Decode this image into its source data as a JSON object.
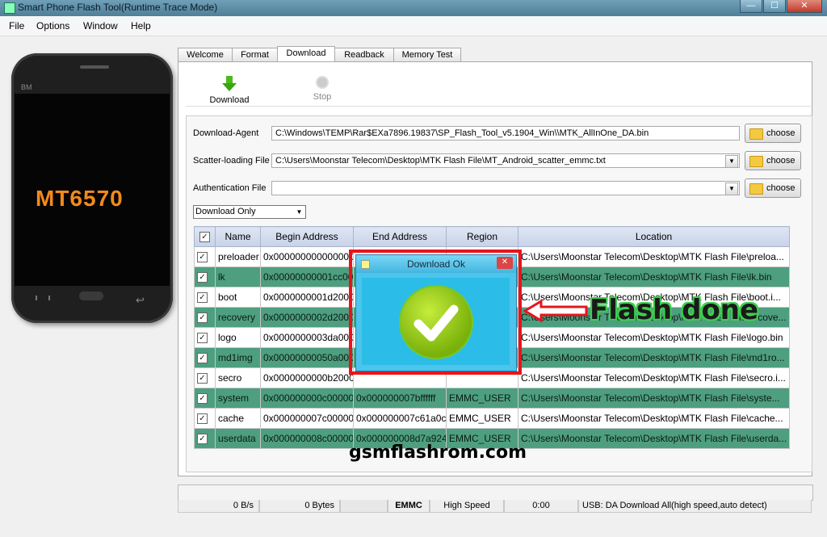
{
  "window": {
    "title": "Smart Phone Flash Tool(Runtime Trace Mode)",
    "minimize": "—",
    "maximize": "☐",
    "close": "✕"
  },
  "menu": [
    "File",
    "Options",
    "Window",
    "Help"
  ],
  "phone": {
    "brand": "BM",
    "model": "MT6570"
  },
  "tabs": [
    "Welcome",
    "Format",
    "Download",
    "Readback",
    "Memory Test"
  ],
  "active_tab": "Download",
  "toolbar": {
    "download_label": "Download",
    "stop_label": "Stop"
  },
  "fields": {
    "download_agent": {
      "label": "Download-Agent",
      "value": "C:\\Windows\\TEMP\\Rar$EXa7896.19837\\SP_Flash_Tool_v5.1904_Win\\\\MTK_AllInOne_DA.bin"
    },
    "scatter": {
      "label": "Scatter-loading File",
      "value": "C:\\Users\\Moonstar Telecom\\Desktop\\MTK Flash File\\MT_Android_scatter_emmc.txt"
    },
    "auth": {
      "label": "Authentication File",
      "value": ""
    },
    "choose_label": "choose",
    "mode": "Download Only"
  },
  "table": {
    "headers": [
      "Name",
      "Begin Address",
      "End Address",
      "Region",
      "Location"
    ],
    "rows": [
      [
        "preloader",
        "0x0000000000000000",
        "",
        "",
        "C:\\Users\\Moonstar Telecom\\Desktop\\MTK Flash File\\preloa..."
      ],
      [
        "lk",
        "0x00000000001cc0000",
        "",
        "",
        "C:\\Users\\Moonstar Telecom\\Desktop\\MTK Flash File\\lk.bin"
      ],
      [
        "boot",
        "0x0000000001d20000",
        "",
        "",
        "C:\\Users\\Moonstar Telecom\\Desktop\\MTK Flash File\\boot.i..."
      ],
      [
        "recovery",
        "0x0000000002d20000",
        "",
        "",
        "C:\\Users\\Moonstar Telecom\\Desktop\\MTK Flash File\\recove..."
      ],
      [
        "logo",
        "0x0000000003da0000",
        "",
        "",
        "C:\\Users\\Moonstar Telecom\\Desktop\\MTK Flash File\\logo.bin"
      ],
      [
        "md1img",
        "0x00000000050a0000",
        "",
        "",
        "C:\\Users\\Moonstar Telecom\\Desktop\\MTK Flash File\\md1ro..."
      ],
      [
        "secro",
        "0x0000000000b200000",
        "",
        "",
        "C:\\Users\\Moonstar Telecom\\Desktop\\MTK Flash File\\secro.i..."
      ],
      [
        "system",
        "0x000000000c000000",
        "0x000000007bffffff",
        "EMMC_USER",
        "C:\\Users\\Moonstar Telecom\\Desktop\\MTK Flash File\\syste..."
      ],
      [
        "cache",
        "0x000000007c000000",
        "0x000000007c61a0cf",
        "EMMC_USER",
        "C:\\Users\\Moonstar Telecom\\Desktop\\MTK Flash File\\cache..."
      ],
      [
        "userdata",
        "0x000000008c000000",
        "0x000000008d7a9243",
        "EMMC_USER",
        "C:\\Users\\Moonstar Telecom\\Desktop\\MTK Flash File\\userda..."
      ]
    ]
  },
  "dialog": {
    "title": "Download Ok",
    "close": "✕"
  },
  "annotation": "Flash done",
  "watermark": "gsmflashrom.com",
  "status": {
    "speed": "0 B/s",
    "bytes": "0 Bytes",
    "storage": "EMMC",
    "mode": "High Speed",
    "time": "0:00",
    "usb": "USB: DA Download All(high speed,auto detect)"
  },
  "colors": {
    "row_green": "#4e9e80",
    "dialog_bg": "#4cc4ec",
    "highlight": "#e8141b",
    "annotation_outline": "#3ecf4e"
  }
}
